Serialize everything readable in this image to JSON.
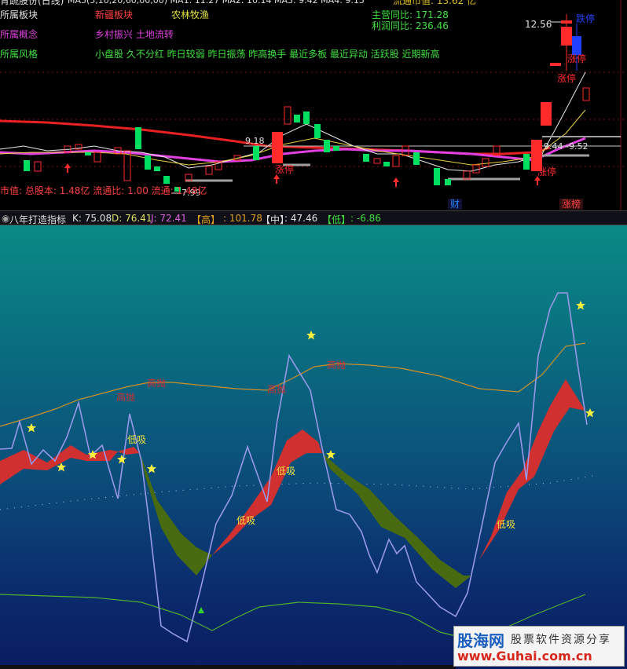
{
  "top": {
    "header_partial": "MA5(5,10,20,60,00,00)  MA1: 11.27  MA2: 10.14  MA3: 9.42  MA4: 9.15",
    "title_partial": "青蔬股份(日线)",
    "industry_label": "所属板块",
    "industry_value1": "新疆板块",
    "industry_value2": "农林牧渔",
    "concept_label": "所属概念",
    "concept_value": "乡村振兴 土地流转",
    "style_label": "所属风格",
    "style_value": "小盘股 久不分红 昨日较弱 昨日振荡 昨高换手 最近多板 最近异动 活跃股 近期新高",
    "circ_cap_partial": "流通市值: 13.62 亿",
    "revenue_yoy": "主营同比: 171.28",
    "profit_yoy": "利润同比: 236.46",
    "price_high": "12.56",
    "tag_ztt": "涨停",
    "tag_dt": "跌停",
    "price_918": "9.18",
    "price_low": "7.99",
    "price_944": "9.44 -9.52",
    "footer": "市值: 总股本: 1.48亿  流通比: 1.00  流通: 1.48亿",
    "tag_cai": "财",
    "tag_zhangbang": "涨榜"
  },
  "indicator": {
    "name": "八年打造指标",
    "k": "K: 75.08",
    "d": "D: 76.41",
    "j": "J: 72.41",
    "high_label": "【高】",
    "high_value": ": 101.78",
    "mid_label": "【中】",
    "mid_value": ": 47.46",
    "low_label": "【低】",
    "low_value": ": -6.86",
    "signal_high": "高抛",
    "signal_low": "低吸"
  },
  "watermark": {
    "logo": "股海网",
    "slogan": "股票软件资源分享",
    "url": "www.Guhai.com.cn"
  },
  "colors": {
    "up": "#ff2a2a",
    "down": "#00e060",
    "ma_red": "#e82020",
    "ma_magenta": "#e040e0",
    "kdj_line": "#9898e8",
    "band_orange": "#d09028",
    "band_green": "#50b030",
    "ribbon_red": "#d03030",
    "ribbon_green": "#486a10",
    "star": "#f8f040"
  }
}
